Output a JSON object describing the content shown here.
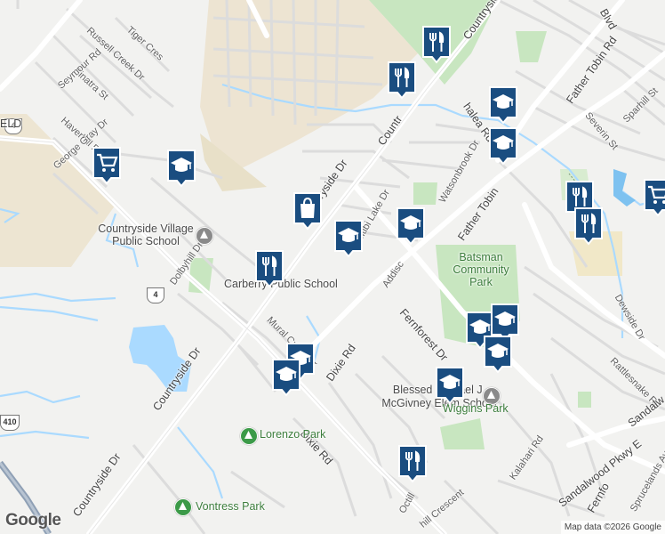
{
  "map": {
    "branding": "Google",
    "attribution": "Map data ©2026 Google",
    "colors": {
      "land": "#f2f2f0",
      "park": "#c8e6c0",
      "water": "#aadaff",
      "major_road": "#ffffff",
      "marker": "#1a4d80"
    },
    "highway_shields": [
      "4",
      "4",
      "410"
    ]
  },
  "labels": {
    "russell_creek": "Russell Creek Dr",
    "tiger_cres": "Tiger Cres",
    "sinatra": "Sinatra St",
    "seymour": "Seymour Rd",
    "haverhill": "Haverhill Rd",
    "george_gray": "George Gray Dr",
    "field": "ELD",
    "dolbyhill": "Dolbyhill Dr",
    "countryside_left": "Countryside Dr",
    "countryside_mid": "Countryside Dr",
    "countryside_top": "Countryside Dr",
    "countryside_top2": "Countr",
    "chalea": "halea Rd",
    "abitibi": "Abitibi Lake Dr",
    "watsonbrook": "Watsonbrook Dr",
    "addiscombe": "Addisc",
    "father_tobin_mid": "Father Tobin",
    "father_tobin_top": "Father Tobin Rd",
    "blvd": "Blvd",
    "severin": "Severin St",
    "sparhill": "Sparhill St",
    "fernforest": "Fernforest Dr",
    "mural_creek": "Mural Creek Dr",
    "dixie_mid": "Dixie Rd",
    "dixie_low": "Dixie Rd",
    "dewside": "Dewside Dr",
    "rattlesnake": "Rattlesnake Rd",
    "kalahari": "Kalahari Rd",
    "sandalwood": "Sandalwood Pkwy E",
    "sandalw": "Sandalw",
    "fernfo": "Fernfo",
    "sprucelands": "Sprucelands Ave",
    "octill": "Octill",
    "hill_crescent": "hill Crescent"
  },
  "places": {
    "countryside_school": "Countryside Village Public School",
    "carberry_school": "Carberry Public School",
    "batsman_park": "Batsman Community Park",
    "blessed_michael": "Blessed Michael J. McGivney Elem School",
    "lorenzo_park": "Lorenzo Park",
    "vontress_park": "Vontress Park",
    "wiggins_park": "Wiggins Park"
  },
  "markers": [
    {
      "type": "restaurant-marker"
    },
    {
      "type": "restaurant-marker"
    },
    {
      "type": "school-marker"
    },
    {
      "type": "school-marker"
    },
    {
      "type": "shopping-cart-marker"
    },
    {
      "type": "school-marker"
    },
    {
      "type": "shopping-bag-marker"
    },
    {
      "type": "school-marker"
    },
    {
      "type": "school-marker"
    },
    {
      "type": "restaurant-marker"
    },
    {
      "type": "restaurant-marker"
    },
    {
      "type": "restaurant-marker"
    },
    {
      "type": "school-marker"
    },
    {
      "type": "school-marker"
    },
    {
      "type": "school-marker"
    },
    {
      "type": "school-marker"
    },
    {
      "type": "school-marker"
    },
    {
      "type": "school-marker"
    },
    {
      "type": "restaurant-marker"
    },
    {
      "type": "shopping-cart-marker"
    }
  ]
}
